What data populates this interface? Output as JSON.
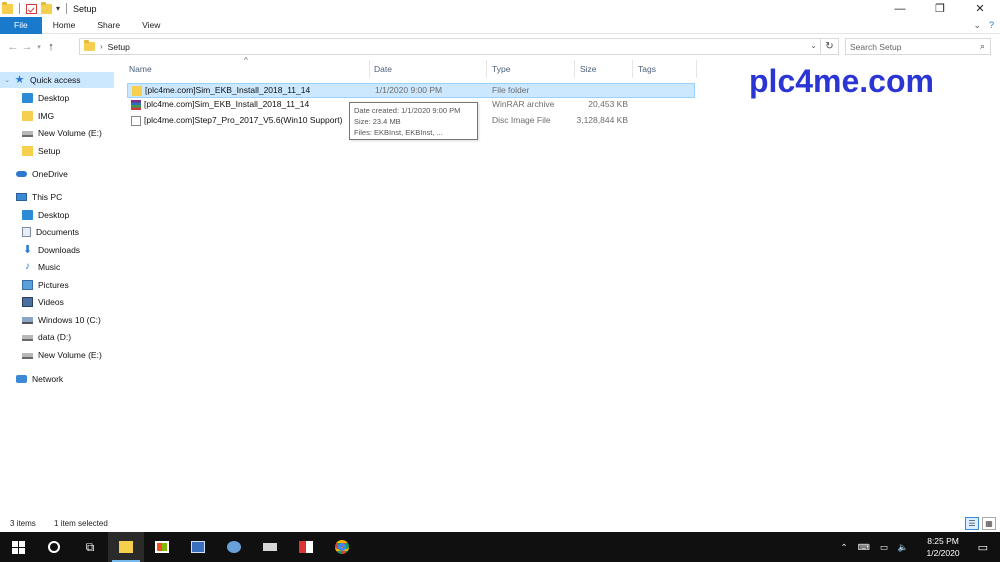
{
  "window": {
    "title": "Setup",
    "controls": {
      "minimize": "—",
      "restore": "❐",
      "close": "✕"
    }
  },
  "ribbon": {
    "tabs": [
      "File",
      "Home",
      "Share",
      "View"
    ],
    "expand_glyph": "⌄",
    "help_glyph": "?"
  },
  "address": {
    "path_segment": "Setup",
    "search_placeholder": "Search Setup"
  },
  "sidebar": {
    "quick_access": "Quick access",
    "quick_items": [
      "Desktop",
      "IMG",
      "New Volume (E:)",
      "Setup"
    ],
    "onedrive": "OneDrive",
    "this_pc": "This PC",
    "pc_items": [
      "Desktop",
      "Documents",
      "Downloads",
      "Music",
      "Pictures",
      "Videos",
      "Windows 10 (C:)",
      "data (D:)",
      "New Volume (E:)"
    ],
    "network": "Network"
  },
  "columns": [
    "Name",
    "Date",
    "Type",
    "Size",
    "Tags"
  ],
  "files": [
    {
      "name": "[plc4me.com]Sim_EKB_Install_2018_11_14",
      "date": "1/1/2020 9:00 PM",
      "type": "File folder",
      "size": "",
      "icon": "folder-icon",
      "selected": true
    },
    {
      "name": "[plc4me.com]Sim_EKB_Install_2018_11_14",
      "date": "",
      "type": "WinRAR archive",
      "size": "20,453 KB",
      "icon": "winrar-icon",
      "selected": false
    },
    {
      "name": "[plc4me.com]Step7_Pro_2017_V5.6(Win10 Support)",
      "date": "",
      "type": "Disc Image File",
      "size": "3,128,844 KB",
      "icon": "disc-image-icon",
      "selected": false
    }
  ],
  "tooltip": {
    "line1": "Date created: 1/1/2020 9:00 PM",
    "line2": "Size: 23.4 MB",
    "line3": "Files: EKBInst, EKBInst, ..."
  },
  "watermark": "plc4me.com",
  "status": {
    "items": "3 items",
    "selected": "1 item selected"
  },
  "taskbar": {
    "time": "8:25 PM",
    "date": "1/2/2020"
  },
  "colors": {
    "file_tab": "#1979ca",
    "selection": "#cce8ff",
    "watermark": "#2b35d4",
    "taskbar": "#101010"
  }
}
